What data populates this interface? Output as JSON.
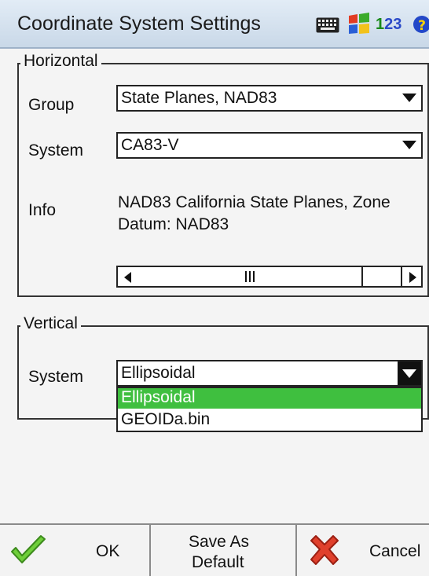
{
  "window": {
    "title": "Coordinate System Settings",
    "tray": {
      "input_digits": "1",
      "input_digits_hl": "2",
      "input_digits_end": "3"
    }
  },
  "horizontal": {
    "legend": "Horizontal",
    "group_label": "Group",
    "group_value": "State Planes, NAD83",
    "system_label": "System",
    "system_value": "CA83-V",
    "info_label": "Info",
    "info_line1": "NAD83 California State Planes, Zone",
    "info_line2": "Datum: NAD83"
  },
  "vertical": {
    "legend": "Vertical",
    "system_label": "System",
    "system_value": "Ellipsoidal",
    "options": [
      "Ellipsoidal",
      "GEOIDa.bin"
    ],
    "selected_index": 0
  },
  "buttons": {
    "ok": "OK",
    "save_default_line1": "Save As",
    "save_default_line2": "Default",
    "cancel": "Cancel"
  },
  "colors": {
    "selection": "#3fbf3f",
    "ok_icon": "#5fbf2f",
    "cancel_icon": "#d93a2a",
    "titlebar": "#c9d8e8"
  }
}
